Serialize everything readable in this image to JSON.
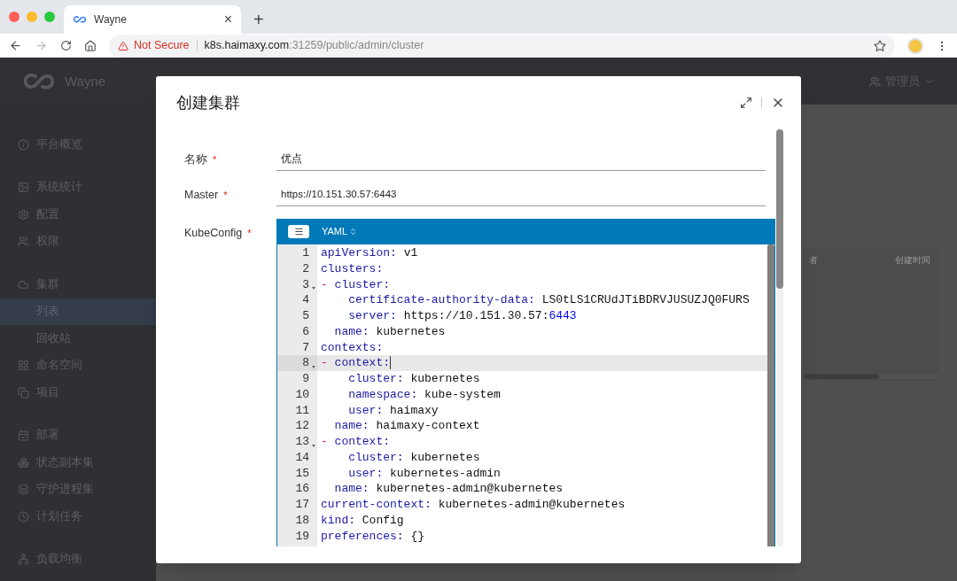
{
  "browser": {
    "tab": {
      "title": "Wayne",
      "close": "×"
    },
    "new_tab": "+",
    "address": {
      "warning": "Not Secure",
      "host": "k8s.haimaxy.com",
      "path": ":31259/public/admin/cluster"
    }
  },
  "header": {
    "logo": "Wayne",
    "user": "管理员"
  },
  "sidebar": {
    "groups": [
      {
        "items": [
          {
            "label": "平台概览",
            "selected": false
          }
        ]
      },
      {
        "items": [
          {
            "label": "系统统计",
            "selected": false
          },
          {
            "label": "配置",
            "selected": false
          },
          {
            "label": "权限",
            "selected": false
          }
        ]
      },
      {
        "items": [
          {
            "label": "集群",
            "selected": false,
            "children": [
              {
                "label": "列表",
                "selected": true
              },
              {
                "label": "回收站",
                "selected": false
              }
            ]
          },
          {
            "label": "命名空间",
            "selected": false
          },
          {
            "label": "项目",
            "selected": false
          }
        ]
      },
      {
        "items": [
          {
            "label": "部署",
            "selected": false
          },
          {
            "label": "状态副本集",
            "selected": false
          },
          {
            "label": "守护进程集",
            "selected": false
          },
          {
            "label": "计划任务",
            "selected": false
          }
        ]
      },
      {
        "items": [
          {
            "label": "负载均衡",
            "selected": false
          }
        ]
      }
    ]
  },
  "table": {
    "columns": [
      "者",
      "创建时间"
    ]
  },
  "dialog": {
    "title": "创建集群",
    "fields": [
      {
        "label": "名称",
        "required_mark": "*",
        "value": "优点"
      },
      {
        "label": "Master",
        "required_mark": "*",
        "value": "https://10.151.30.57:6443"
      }
    ],
    "editor": {
      "label": "KubeConfig",
      "required_mark": "*",
      "mode": "YAML",
      "lines": [
        {
          "number": "1",
          "foldable": false,
          "active": false,
          "tokens": [
            {
              "kind": "key",
              "text": "apiVersion:"
            },
            {
              "kind": "value",
              "text": " v1"
            }
          ]
        },
        {
          "number": "2",
          "foldable": false,
          "active": false,
          "tokens": [
            {
              "kind": "key",
              "text": "clusters:"
            }
          ]
        },
        {
          "number": "3",
          "foldable": true,
          "active": false,
          "tokens": [
            {
              "kind": "dash",
              "text": "- "
            },
            {
              "kind": "key",
              "text": "cluster:"
            }
          ]
        },
        {
          "number": "4",
          "foldable": false,
          "active": false,
          "tokens": [
            {
              "kind": "key",
              "text": "    certificate-authority-data:"
            },
            {
              "kind": "value",
              "text": " LS0tLS1CRUdJTiBDRVJUSUZJQ0FURS"
            }
          ]
        },
        {
          "number": "5",
          "foldable": false,
          "active": false,
          "tokens": [
            {
              "kind": "key",
              "text": "    server:"
            },
            {
              "kind": "value",
              "text": " https://10.151.30.57:"
            },
            {
              "kind": "number",
              "text": "6443"
            }
          ]
        },
        {
          "number": "6",
          "foldable": false,
          "active": false,
          "tokens": [
            {
              "kind": "key",
              "text": "  name:"
            },
            {
              "kind": "value",
              "text": " kubernetes"
            }
          ]
        },
        {
          "number": "7",
          "foldable": false,
          "active": false,
          "tokens": [
            {
              "kind": "key",
              "text": "contexts:"
            }
          ]
        },
        {
          "number": "8",
          "foldable": true,
          "active": true,
          "tokens": [
            {
              "kind": "dash",
              "text": "- "
            },
            {
              "kind": "key",
              "text": "context:"
            }
          ]
        },
        {
          "number": "9",
          "foldable": false,
          "active": false,
          "tokens": [
            {
              "kind": "key",
              "text": "    cluster:"
            },
            {
              "kind": "value",
              "text": " kubernetes"
            }
          ]
        },
        {
          "number": "10",
          "foldable": false,
          "active": false,
          "tokens": [
            {
              "kind": "key",
              "text": "    namespace:"
            },
            {
              "kind": "value",
              "text": " kube-system"
            }
          ]
        },
        {
          "number": "11",
          "foldable": false,
          "active": false,
          "tokens": [
            {
              "kind": "key",
              "text": "    user:"
            },
            {
              "kind": "value",
              "text": " haimaxy"
            }
          ]
        },
        {
          "number": "12",
          "foldable": false,
          "active": false,
          "tokens": [
            {
              "kind": "key",
              "text": "  name:"
            },
            {
              "kind": "value",
              "text": " haimaxy-context"
            }
          ]
        },
        {
          "number": "13",
          "foldable": true,
          "active": false,
          "tokens": [
            {
              "kind": "dash",
              "text": "- "
            },
            {
              "kind": "key",
              "text": "context:"
            }
          ]
        },
        {
          "number": "14",
          "foldable": false,
          "active": false,
          "tokens": [
            {
              "kind": "key",
              "text": "    cluster:"
            },
            {
              "kind": "value",
              "text": " kubernetes"
            }
          ]
        },
        {
          "number": "15",
          "foldable": false,
          "active": false,
          "tokens": [
            {
              "kind": "key",
              "text": "    user:"
            },
            {
              "kind": "value",
              "text": " kubernetes-admin"
            }
          ]
        },
        {
          "number": "16",
          "foldable": false,
          "active": false,
          "tokens": [
            {
              "kind": "key",
              "text": "  name:"
            },
            {
              "kind": "value",
              "text": " kubernetes-admin@kubernetes"
            }
          ]
        },
        {
          "number": "17",
          "foldable": false,
          "active": false,
          "tokens": [
            {
              "kind": "key",
              "text": "current-context:"
            },
            {
              "kind": "value",
              "text": " kubernetes-admin@kubernetes"
            }
          ]
        },
        {
          "number": "18",
          "foldable": false,
          "active": false,
          "tokens": [
            {
              "kind": "key",
              "text": "kind:"
            },
            {
              "kind": "value",
              "text": " Config"
            }
          ]
        },
        {
          "number": "19",
          "foldable": false,
          "active": false,
          "tokens": [
            {
              "kind": "key",
              "text": "preferences:"
            },
            {
              "kind": "value",
              "text": " {}"
            }
          ]
        }
      ]
    }
  }
}
